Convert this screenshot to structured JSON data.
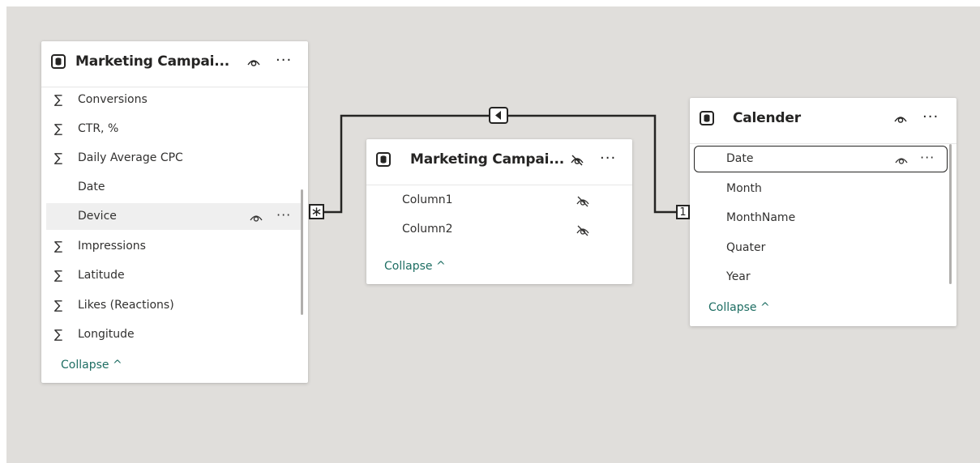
{
  "tables": {
    "left": {
      "title": "Marketing Campai...",
      "fields": [
        {
          "label": "Conversions",
          "sigma": "∑"
        },
        {
          "label": "CTR, %",
          "sigma": "∑"
        },
        {
          "label": "Daily Average CPC",
          "sigma": "∑"
        },
        {
          "label": "Date",
          "sigma": ""
        },
        {
          "label": "Device",
          "sigma": ""
        },
        {
          "label": "Impressions",
          "sigma": "∑"
        },
        {
          "label": "Latitude",
          "sigma": "∑"
        },
        {
          "label": "Likes (Reactions)",
          "sigma": "∑"
        },
        {
          "label": "Longitude",
          "sigma": "∑"
        }
      ],
      "collapse": "Collapse ^",
      "more": "···"
    },
    "middle": {
      "title": "Marketing Campai...",
      "fields": [
        {
          "label": "Column1"
        },
        {
          "label": "Column2"
        }
      ],
      "collapse": "Collapse ^",
      "more": "···"
    },
    "right": {
      "title": "Calender",
      "fields": [
        {
          "label": "Date"
        },
        {
          "label": "Month"
        },
        {
          "label": "MonthName"
        },
        {
          "label": "Quater"
        },
        {
          "label": "Year"
        }
      ],
      "collapse": "Collapse ^",
      "more": "···"
    }
  },
  "relationship": {
    "many_marker": "∗",
    "one_marker": "1",
    "direction_icon": "triangle-left-icon"
  },
  "colors": {
    "canvas": "#e0dedb",
    "collapse_link": "#1e6e63",
    "line": "#252423"
  }
}
